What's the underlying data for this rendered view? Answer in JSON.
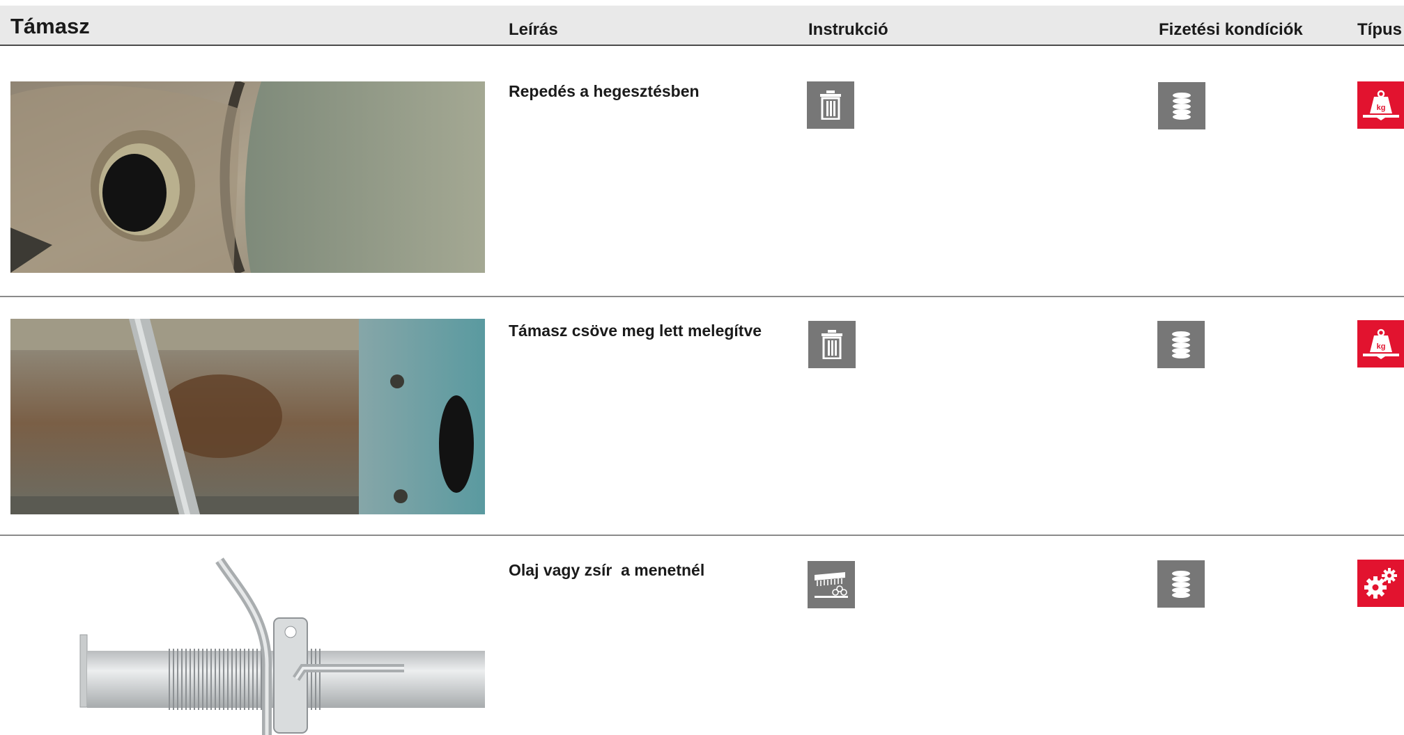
{
  "header": {
    "title": "Támasz",
    "col_description": "Leírás",
    "col_instruction": "Instrukció",
    "col_payment": "Fizetési kondíciók",
    "col_type": "Típus"
  },
  "rows": [
    {
      "photo_name": "weld-crack-photo",
      "description": "Repedés a hegesztésben",
      "instruction_icon": "trash-icon",
      "payment_icon": "coin-stack-icon",
      "type_icon": "weight-kg-icon"
    },
    {
      "photo_name": "heated-tube-photo",
      "description": "Támasz csöve meg lett melegítve",
      "instruction_icon": "trash-icon",
      "payment_icon": "coin-stack-icon",
      "type_icon": "weight-kg-icon"
    },
    {
      "photo_name": "threaded-prop-illustration",
      "description": "Olaj vagy zsír  a menetnél",
      "instruction_icon": "brush-clean-icon",
      "payment_icon": "coin-stack-icon",
      "type_icon": "gears-icon"
    }
  ],
  "icon_labels": {
    "weight_text": "kg"
  },
  "colors": {
    "header_bg": "#e9e9e9",
    "icon_gray": "#777777",
    "icon_red": "#e2132f"
  }
}
